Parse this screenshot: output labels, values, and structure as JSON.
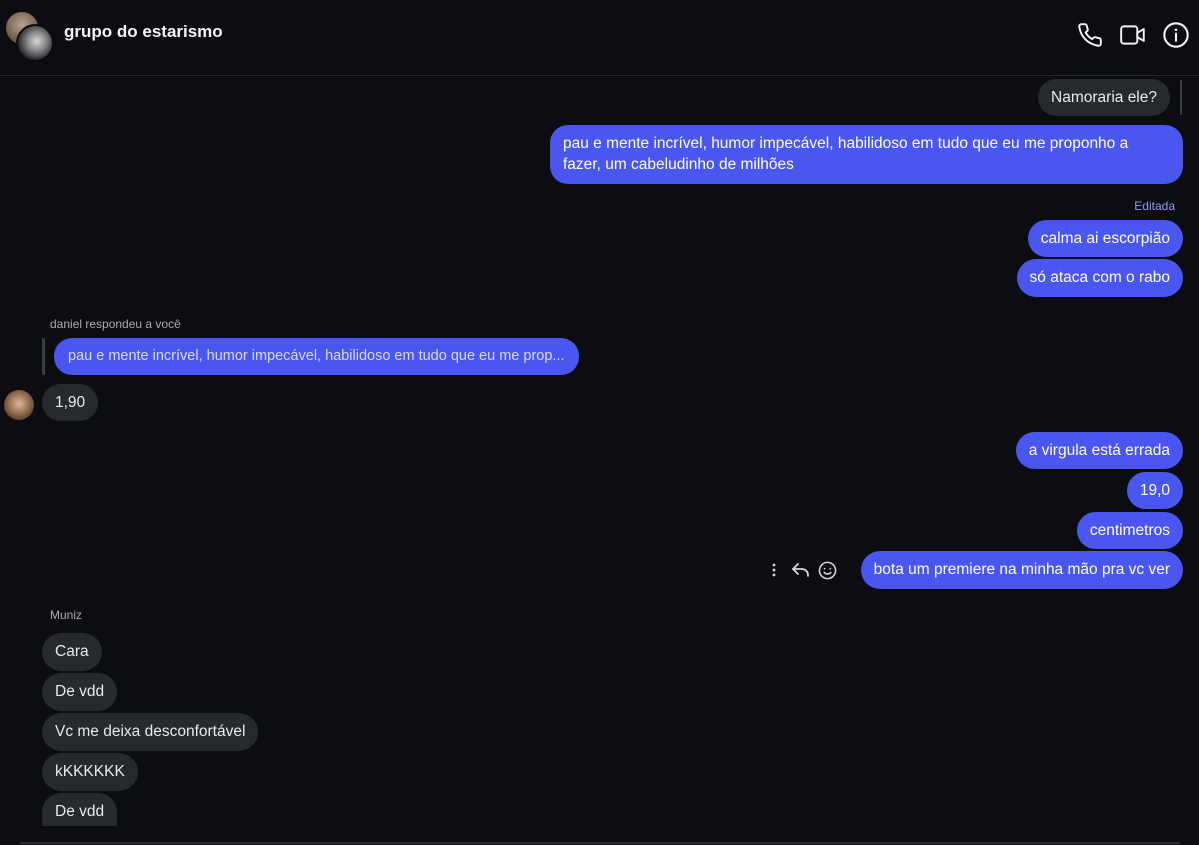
{
  "header": {
    "title": "grupo do estarismo",
    "icons": [
      "phone-icon",
      "video-icon",
      "info-icon"
    ]
  },
  "messages": {
    "m0": "Namoraria ele?",
    "m1": "pau e mente incrível, humor impecável, habilidoso em tudo que eu me proponho a fazer, um cabeludinho de milhões",
    "edited": "Editada",
    "m2": "calma ai escorpião",
    "m3": "só ataca com o rabo",
    "reply_label": "daniel respondeu a você",
    "reply_quote": "pau e mente incrível, humor impecável, habilidoso em tudo que eu me prop...",
    "m4": "1,90",
    "m5": "a virgula está errada",
    "m6": "19,0",
    "m7": "centimetros",
    "m8": "bota um premiere na minha mão pra vc ver",
    "sender_muniz": "Muniz",
    "m9": "Cara",
    "m10": "De vdd",
    "m11": "Vc me deixa desconfortável",
    "m12": "kKKKKKK",
    "m13": "De vdd"
  },
  "colors": {
    "background": "#0b0d12",
    "outgoing_bubble": "#4a56f0",
    "incoming_bubble": "#26292e",
    "edited_label": "#8c9cff"
  }
}
